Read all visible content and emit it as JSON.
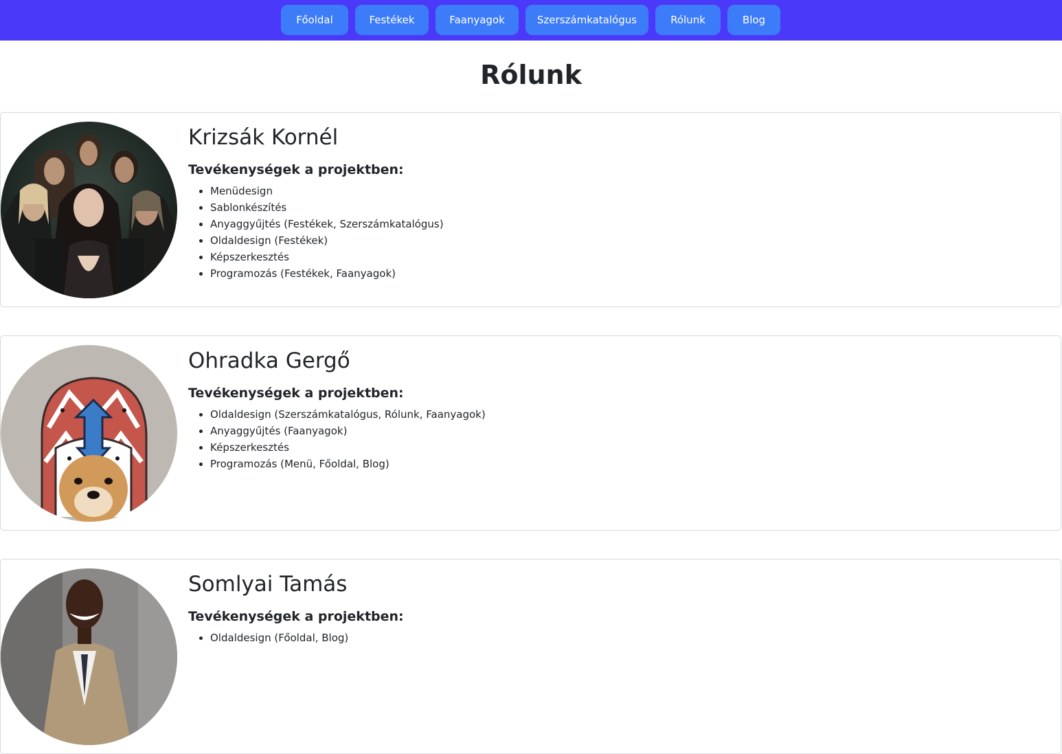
{
  "nav": {
    "items": [
      "Főoldal",
      "Festékek",
      "Faanyagok",
      "Szerszámkatalógus",
      "Rólunk",
      "Blog"
    ]
  },
  "page_title": "Rólunk",
  "members": [
    {
      "name": "Krizsák Kornél",
      "activities_heading": "Tevékenységek a projektben:",
      "activities": [
        "Menüdesign",
        "Sablonkészítés",
        "Anyaggyűjtés (Festékek, Szerszámkatalógus)",
        "Oldaldesign (Festékek)",
        "Képszerkesztés",
        "Programozás (Festékek, Faanyagok)"
      ]
    },
    {
      "name": "Ohradka Gergő",
      "activities_heading": "Tevékenységek a projektben:",
      "activities": [
        "Oldaldesign (Szerszámkatalógus, Rólunk, Faanyagok)",
        "Anyaggyűjtés (Faanyagok)",
        "Képszerkesztés",
        "Programozás (Menü, Főoldal, Blog)"
      ]
    },
    {
      "name": "Somlyai Tamás",
      "activities_heading": "Tevékenységek a projektben:",
      "activities": [
        "Oldaldesign (Főoldal, Blog)"
      ]
    }
  ],
  "colors": {
    "navbar_bg": "#4b39fa",
    "nav_button_bg": "#3d7cf8",
    "text": "#212529",
    "card_border": "#d5d8db"
  }
}
